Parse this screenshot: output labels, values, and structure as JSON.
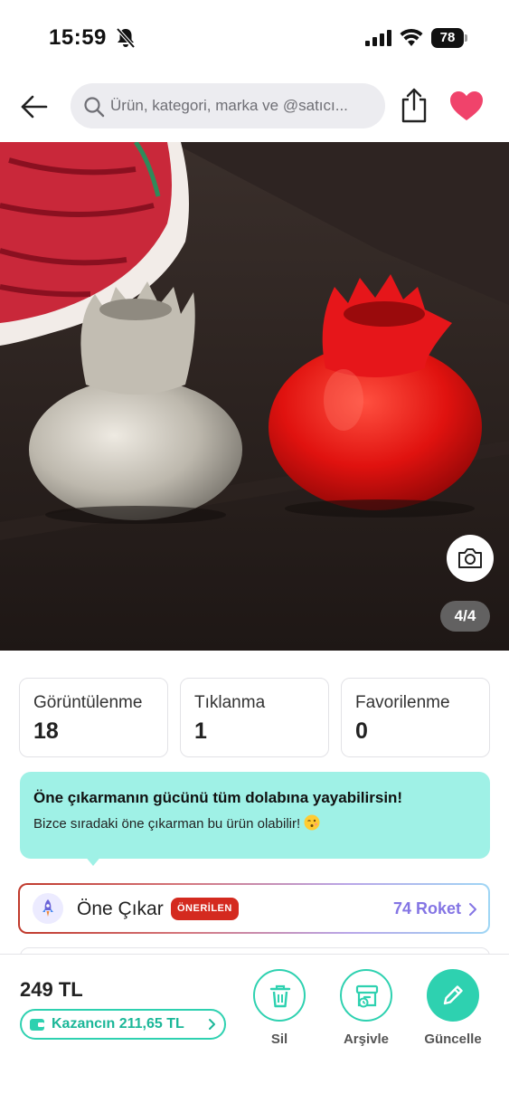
{
  "status_bar": {
    "time": "15:59",
    "battery": "78"
  },
  "nav": {
    "search_placeholder": "Ürün, kategori, marka ve @satıcı..."
  },
  "gallery": {
    "counter": "4/4"
  },
  "stats": [
    {
      "label": "Görüntülenme",
      "value": "18"
    },
    {
      "label": "Tıklanma",
      "value": "1"
    },
    {
      "label": "Favorilenme",
      "value": "0"
    }
  ],
  "promo": {
    "title": "Öne çıkarmanın gücünü tüm dolabına yayabilirsin!",
    "subtitle": "Bizce sıradaki öne çıkarman bu ürün olabilir!"
  },
  "feature": {
    "label": "Öne Çıkar",
    "badge": "ÖNERİLEN",
    "cost": "74 Roket"
  },
  "bottom": {
    "price": "249 TL",
    "earnings": "Kazancın 211,65 TL",
    "actions": [
      {
        "label": "Sil",
        "icon": "trash-icon"
      },
      {
        "label": "Arşivle",
        "icon": "archive-icon"
      },
      {
        "label": "Güncelle",
        "icon": "pencil-icon"
      }
    ]
  },
  "colors": {
    "accent_teal": "#2ed1b0",
    "promo_bg": "#9ff1e6",
    "badge_red": "#d42a1f",
    "roket_purple": "#8475e4",
    "heart_pink": "#f0436b"
  }
}
